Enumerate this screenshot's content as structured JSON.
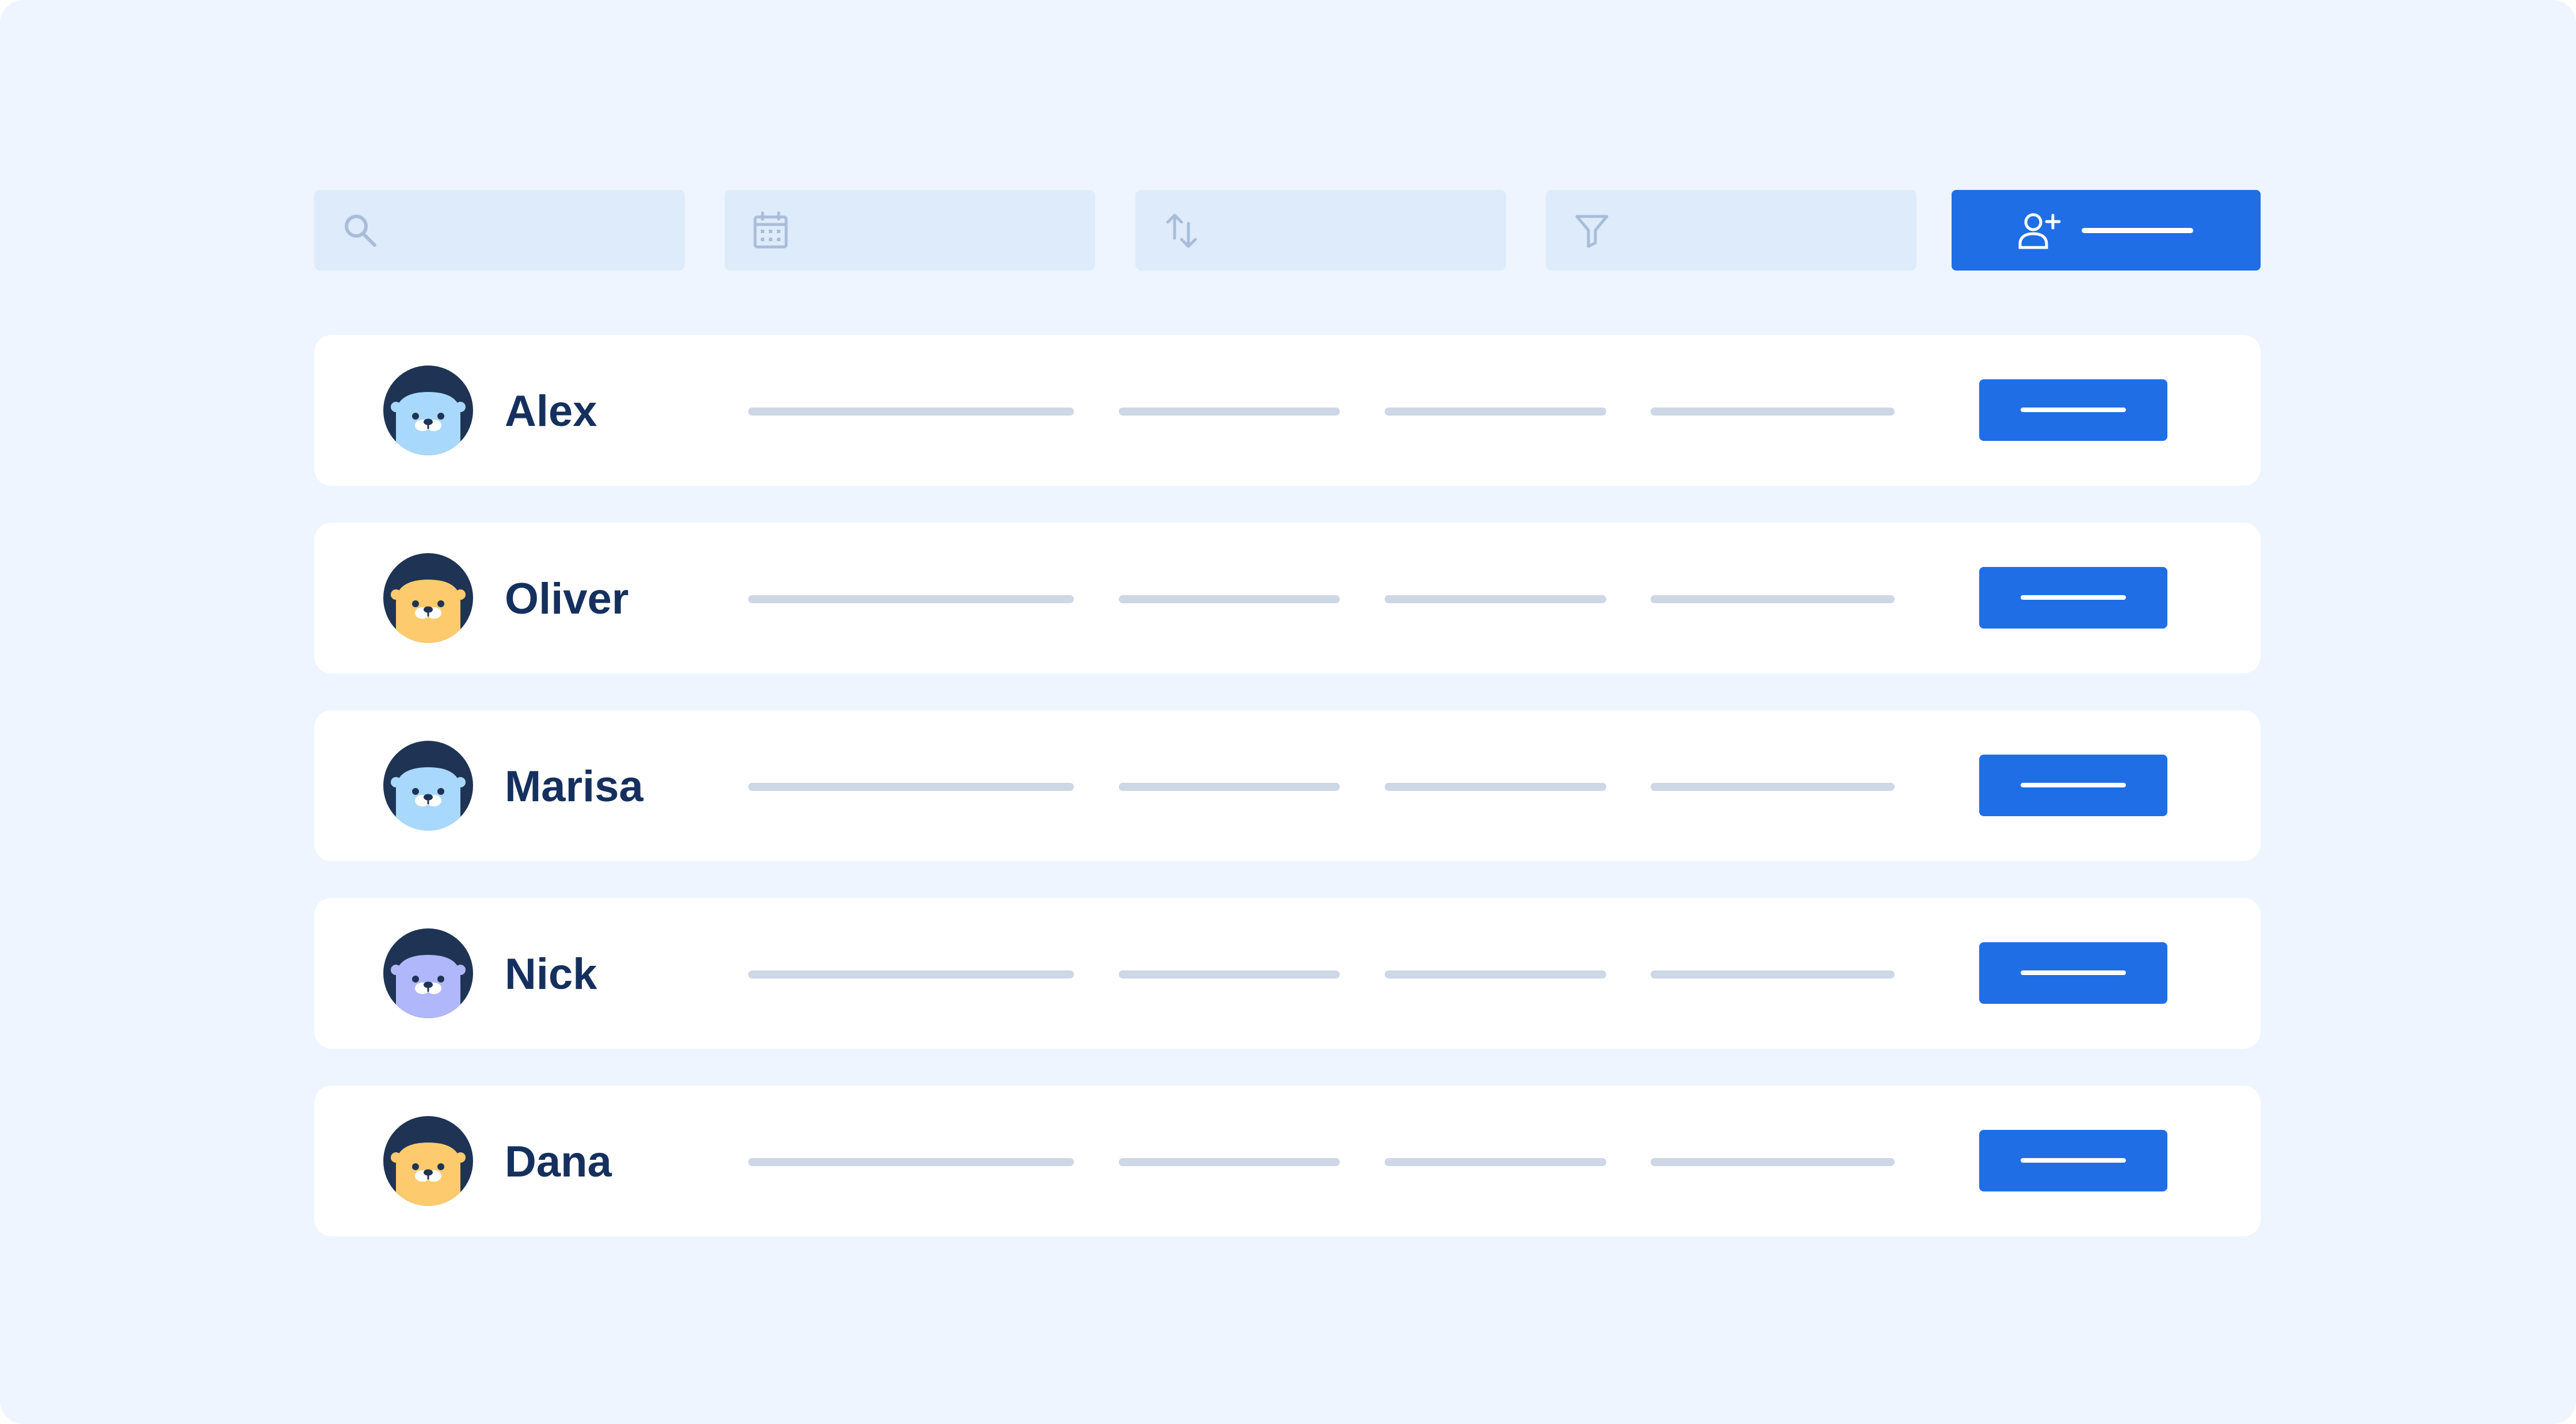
{
  "toolbar": {
    "search_icon": "search-icon",
    "date_icon": "calendar-icon",
    "sort_icon": "sort-arrows-icon",
    "filter_icon": "filter-icon",
    "add_button_icon": "add-user-icon"
  },
  "colors": {
    "background": "#eef5fe",
    "toolbar_field": "#deebfa",
    "accent": "#1f6ee6",
    "row_background": "#ffffff",
    "name_text": "#15305e",
    "placeholder_line": "#cdd7e5",
    "avatar_blue": "#a8d8fb",
    "avatar_yellow": "#fdca6e",
    "avatar_purple": "#b0b7fb",
    "avatar_dark": "#1f3454"
  },
  "users": [
    {
      "name": "Alex",
      "avatar": "otter-avatar-blue"
    },
    {
      "name": "Oliver",
      "avatar": "otter-avatar-yellow"
    },
    {
      "name": "Marisa",
      "avatar": "otter-avatar-blue"
    },
    {
      "name": "Nick",
      "avatar": "otter-avatar-purple"
    },
    {
      "name": "Dana",
      "avatar": "otter-avatar-yellow"
    }
  ]
}
